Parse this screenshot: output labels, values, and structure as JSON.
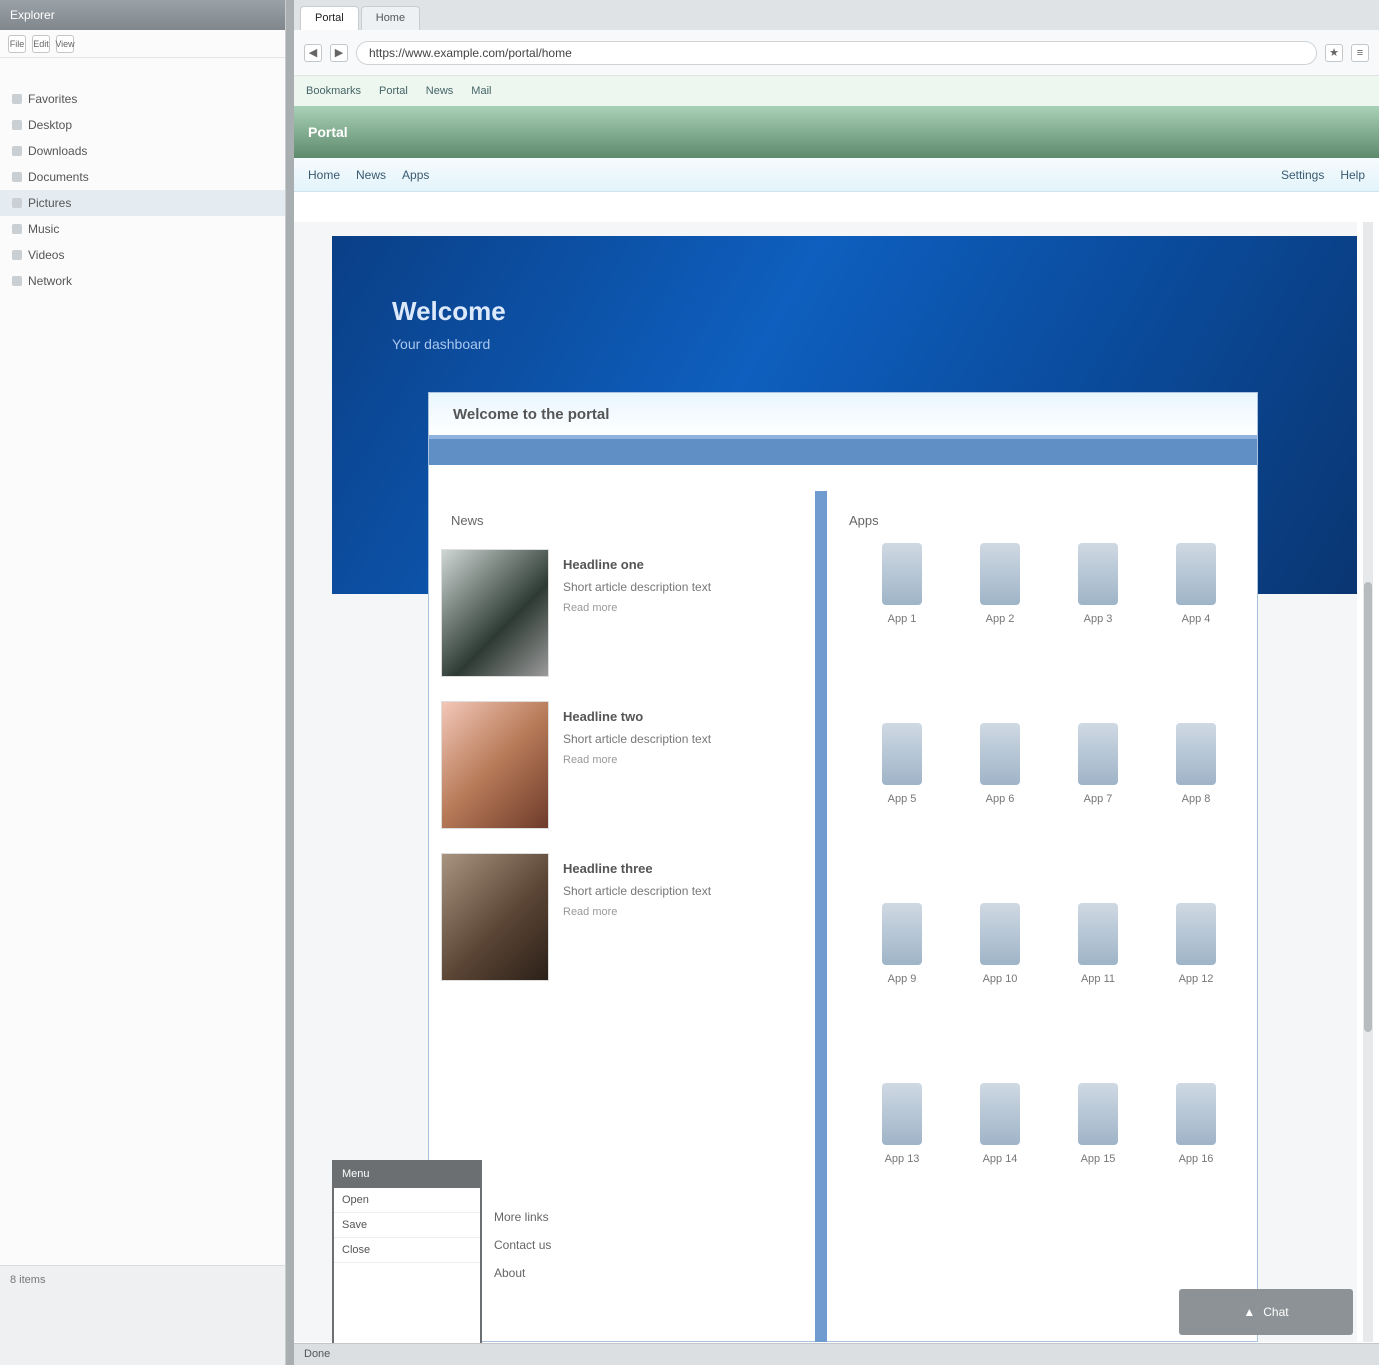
{
  "left": {
    "title": "Explorer",
    "toolbar": [
      "File",
      "Edit",
      "View"
    ],
    "items": [
      {
        "label": "Favorites"
      },
      {
        "label": "Desktop"
      },
      {
        "label": "Downloads"
      },
      {
        "label": "Documents"
      },
      {
        "label": "Pictures"
      },
      {
        "label": "Music"
      },
      {
        "label": "Videos"
      },
      {
        "label": "Network"
      }
    ],
    "bottom_label": "8 items"
  },
  "browser": {
    "tabs": [
      {
        "label": "Portal"
      },
      {
        "label": "Home"
      }
    ],
    "url": "https://www.example.com/portal/home",
    "bookmarks": [
      "Bookmarks",
      "Portal",
      "News",
      "Mail"
    ],
    "banner_title": "Portal",
    "subbar": {
      "left": [
        "Home",
        "News",
        "Apps"
      ],
      "right": [
        "Settings",
        "Help"
      ]
    }
  },
  "hero": {
    "title": "Welcome",
    "subtitle": "Your dashboard"
  },
  "panel": {
    "title": "Welcome to the portal",
    "left_title": "News",
    "right_title": "Apps",
    "articles": [
      {
        "title": "Headline one",
        "desc": "Short article description text",
        "meta": "Read more"
      },
      {
        "title": "Headline two",
        "desc": "Short article description text",
        "meta": "Read more"
      },
      {
        "title": "Headline three",
        "desc": "Short article description text",
        "meta": "Read more"
      }
    ],
    "apps": [
      {
        "label": "App 1"
      },
      {
        "label": "App 2"
      },
      {
        "label": "App 3"
      },
      {
        "label": "App 4"
      },
      {
        "label": "App 5"
      },
      {
        "label": "App 6"
      },
      {
        "label": "App 7"
      },
      {
        "label": "App 8"
      },
      {
        "label": "App 9"
      },
      {
        "label": "App 10"
      },
      {
        "label": "App 11"
      },
      {
        "label": "App 12"
      },
      {
        "label": "App 13"
      },
      {
        "label": "App 14"
      },
      {
        "label": "App 15"
      },
      {
        "label": "App 16"
      }
    ]
  },
  "popup": {
    "header": "Menu",
    "items": [
      "Open",
      "Save",
      "Close"
    ]
  },
  "popup_text": [
    "More links",
    "Contact us",
    "About"
  ],
  "status": "Done",
  "badge": "Chat",
  "colors": {
    "hero": "#0e5fbf",
    "banner": "#5e8a6c",
    "panel_border": "#a9c2df"
  }
}
